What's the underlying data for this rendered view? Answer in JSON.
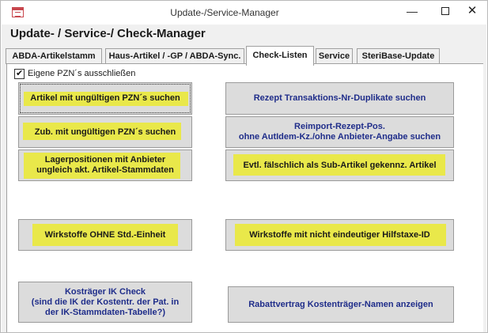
{
  "window": {
    "title": "Update-/Service-Manager"
  },
  "heading": "Update- / Service-/ Check-Manager",
  "tabs": [
    {
      "label": "ABDA-Artikelstamm"
    },
    {
      "label": "Haus-Artikel / -GP / ABDA-Sync."
    },
    {
      "label": "Check-Listen",
      "active": true
    },
    {
      "label": "Service"
    },
    {
      "label": "SteriBase-Update"
    }
  ],
  "checkbox": {
    "label": "Eigene PZN´s ausschließen",
    "checked": true
  },
  "buttons": {
    "b1": "Artikel mit ungültigen PZN´s suchen",
    "b2": "Rezept Transaktions-Nr-Duplikate suchen",
    "b3": "Zub. mit ungültigen PZN´s suchen",
    "b4_line1": "Reimport-Rezept-Pos.",
    "b4_line2": "ohne AutIdem-Kz./ohne Anbieter-Angabe  suchen",
    "b5_line1": "Lagerpositionen mit Anbieter",
    "b5_line2": "ungleich akt. Artikel-Stammdaten",
    "b6": "Evtl. fälschlich als Sub-Artikel gekennz. Artikel",
    "b7": "Wirkstoffe OHNE Std.-Einheit",
    "b8": "Wirkstoffe mit nicht eindeutiger Hilfstaxe-ID",
    "b9_line1": "Kosträger IK Check",
    "b9_line2": "(sind die IK der Kostentr. der Pat.  in",
    "b9_line3": "der IK-Stammdaten-Tabelle?)",
    "b10": "Rabattvertrag Kostenträger-Namen anzeigen"
  },
  "colors": {
    "highlight": "#e9e84a",
    "blue_text": "#1f2d8a",
    "button_bg": "#dcdcdc"
  }
}
